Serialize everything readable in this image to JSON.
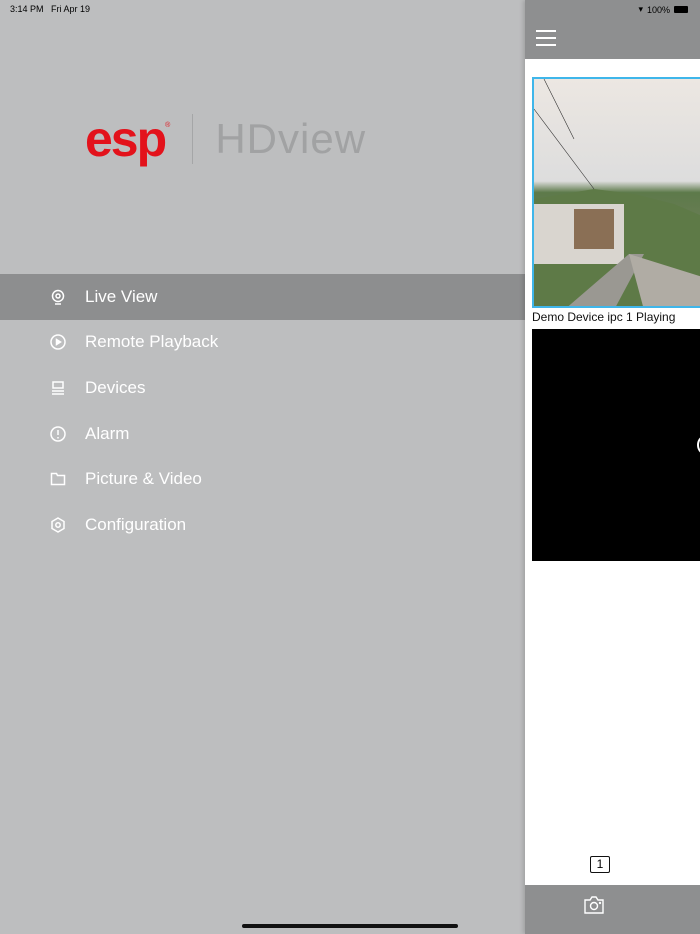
{
  "status_bar": {
    "time": "3:14 PM",
    "date": "Fri Apr 19",
    "battery": "100%"
  },
  "logo": {
    "brand": "esp",
    "product": "HDview"
  },
  "menu": {
    "items": [
      {
        "label": "Live View",
        "icon": "webcam-icon",
        "active": true
      },
      {
        "label": "Remote Playback",
        "icon": "play-circle-icon"
      },
      {
        "label": "Devices",
        "icon": "devices-icon"
      },
      {
        "label": "Alarm",
        "icon": "alert-circle-icon"
      },
      {
        "label": "Picture & Video",
        "icon": "folder-icon"
      },
      {
        "label": "Configuration",
        "icon": "gear-icon"
      }
    ]
  },
  "live": {
    "caption": "Demo Device ipc 1 Playing",
    "page": "1"
  },
  "colors": {
    "accent": "#3fb6ea",
    "brand": "#e3121b"
  }
}
